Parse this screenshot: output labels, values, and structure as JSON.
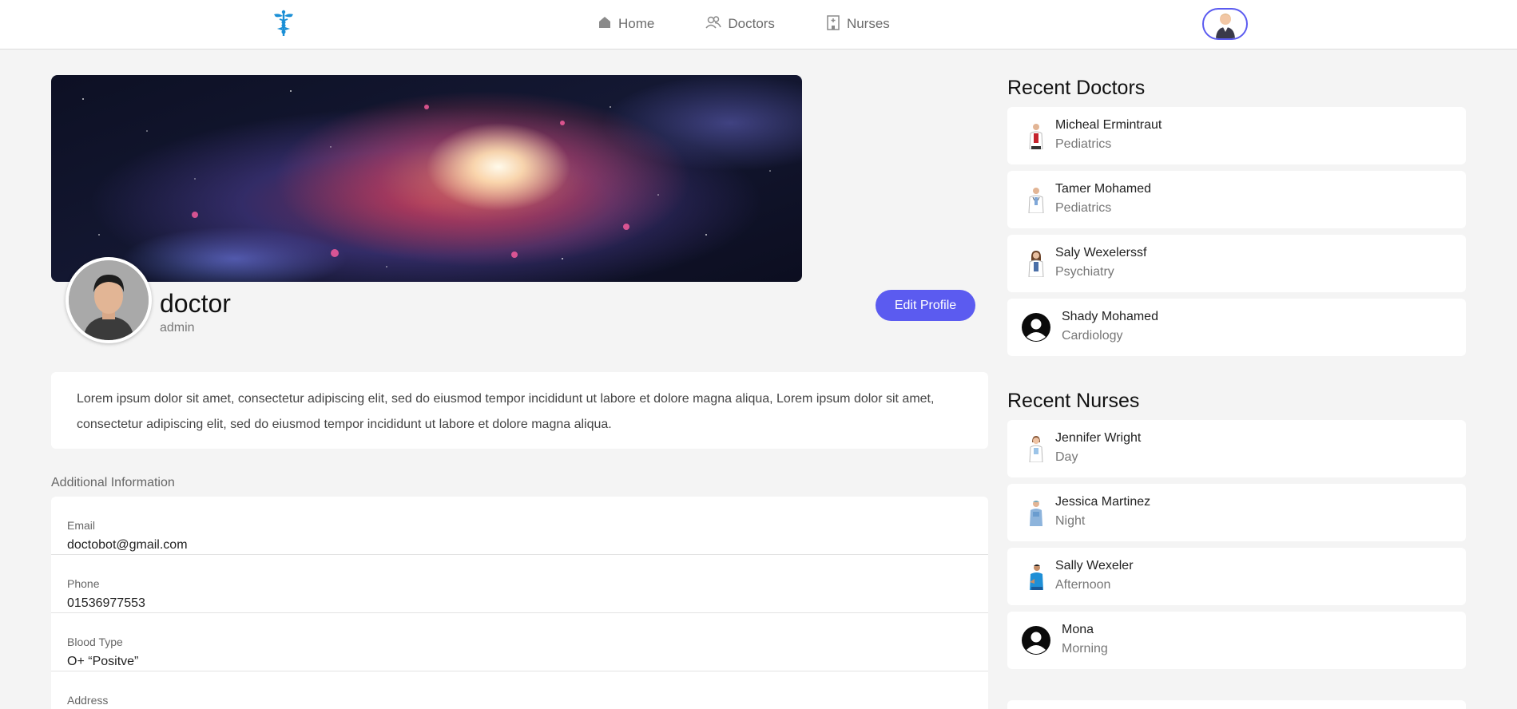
{
  "nav": {
    "items": [
      {
        "label": "Home",
        "icon": "home-icon"
      },
      {
        "label": "Doctors",
        "icon": "users-icon"
      },
      {
        "label": "Nurses",
        "icon": "hospital-icon"
      }
    ]
  },
  "profile": {
    "name": "doctor",
    "role": "admin",
    "edit_label": "Edit Profile",
    "bio": "Lorem ipsum dolor sit amet, consectetur adipiscing elit, sed do eiusmod tempor incididunt ut labore et dolore magna aliqua, Lorem ipsum dolor sit amet, consectetur adipiscing elit, sed do eiusmod tempor incididunt ut labore et dolore magna aliqua."
  },
  "additional": {
    "title": "Additional Information",
    "fields": [
      {
        "label": "Email",
        "value": "doctobot@gmail.com"
      },
      {
        "label": "Phone",
        "value": "01536977553"
      },
      {
        "label": "Blood Type",
        "value": "O+ “Positve”"
      },
      {
        "label": "Address",
        "value": ""
      }
    ]
  },
  "recent_doctors": {
    "title": "Recent Doctors",
    "items": [
      {
        "name": "Micheal Ermintraut",
        "sub": "Pediatrics"
      },
      {
        "name": "Tamer Mohamed",
        "sub": "Pediatrics"
      },
      {
        "name": "Saly Wexelerssf",
        "sub": "Psychiatry"
      },
      {
        "name": "Shady Mohamed",
        "sub": "Cardiology"
      }
    ]
  },
  "recent_nurses": {
    "title": "Recent Nurses",
    "items": [
      {
        "name": "Jennifer Wright",
        "sub": "Day"
      },
      {
        "name": "Jessica Martinez",
        "sub": "Night"
      },
      {
        "name": "Sally Wexeler",
        "sub": "Afternoon"
      },
      {
        "name": "Mona",
        "sub": "Morning"
      }
    ]
  },
  "colors": {
    "accent": "#5b5bf0",
    "logo": "#1a8fd6",
    "background": "#f4f4f4"
  }
}
